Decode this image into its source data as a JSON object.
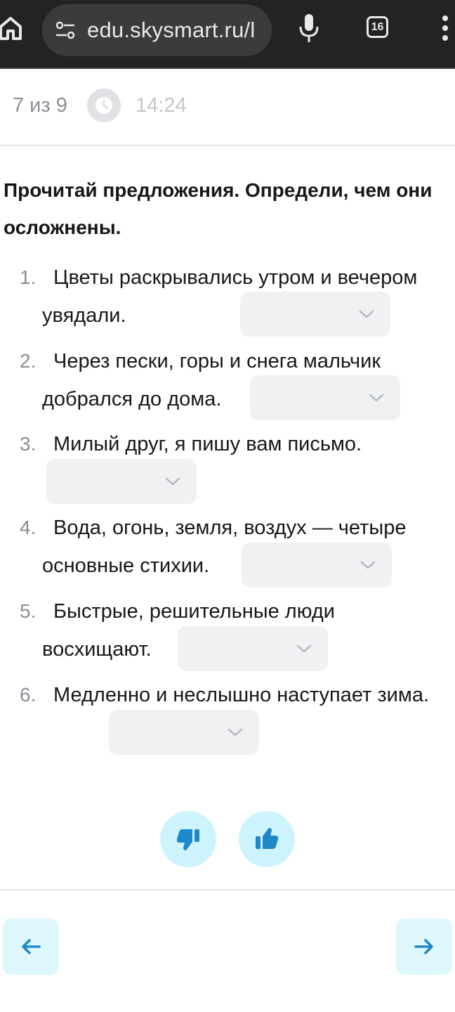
{
  "browser": {
    "url": "edu.skysmart.ru/l",
    "tab_count": "16"
  },
  "progress": {
    "counter": "7 из 9",
    "timer": "14:24"
  },
  "question": {
    "title": "Прочитай предложения. Определи, чем они осложнены."
  },
  "items": [
    {
      "number": "1.",
      "text": "Цветы раскрывались утром и вечером увядали.",
      "selected": ""
    },
    {
      "number": "2.",
      "text": "Через пески, горы и снега мальчик добрался до дома.",
      "selected": ""
    },
    {
      "number": "3.",
      "text": "Милый друг, я пишу вам письмо.",
      "selected": ""
    },
    {
      "number": "4.",
      "text": "Вода, огонь, земля, воздух — четыре основные стихии.",
      "selected": ""
    },
    {
      "number": "5.",
      "text": "Быстрые, решительные люди восхищают.",
      "selected": ""
    },
    {
      "number": "6.",
      "text": "Медленно и неслышно наступает зима.",
      "selected": ""
    }
  ],
  "icons": {
    "home": "home-icon",
    "site_settings": "tune-icon",
    "mic": "mic-icon",
    "more": "more-vert-icon",
    "clock": "clock-icon",
    "dislike": "thumbs-down-icon",
    "like": "thumbs-up-icon",
    "back": "arrow-left-icon",
    "next": "arrow-right-icon"
  },
  "colors": {
    "accent": "#1e88c9",
    "feedback_bg": "#cdf4fd",
    "dropdown_bg": "#f0f1f3"
  }
}
